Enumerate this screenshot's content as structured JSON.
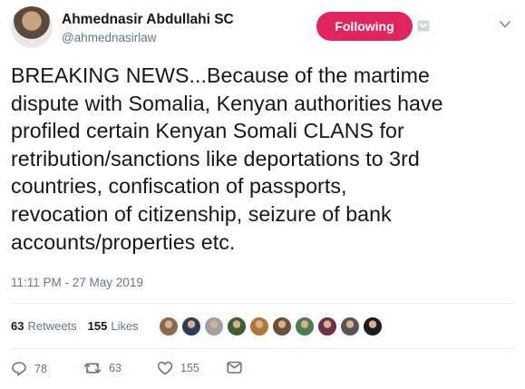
{
  "author": {
    "name": "Ahmednasir Abdullahi SC",
    "handle": "@ahmednasirlaw",
    "follow_button_label": "Following"
  },
  "tweet": {
    "text": "BREAKING NEWS...Because of the martime\ndispute with Somalia, Kenyan authorities have\nprofiled certain Kenyan Somali CLANS for\nretribution/sanctions like deportations to 3rd\ncountries,  confiscation of passports,\nrevocation of citizenship, seizure of bank\naccounts/properties etc.",
    "timestamp": "11:11 PM - 27 May 2019"
  },
  "stats": {
    "retweets_count": "63",
    "retweets_label": "Retweets",
    "likes_count": "155",
    "likes_label": "Likes"
  },
  "liker_avatars": [
    {
      "color": "#8a6a4f"
    },
    {
      "color": "#2f3b5c"
    },
    {
      "color": "#a0a0a0"
    },
    {
      "color": "#3d5e2f"
    },
    {
      "color": "#b0733a"
    },
    {
      "color": "#6b4f3a"
    },
    {
      "color": "#4e7d54"
    },
    {
      "color": "#6a2f4a"
    },
    {
      "color": "#555555"
    },
    {
      "color": "#1c1c1c"
    }
  ],
  "actions": {
    "replies": "78",
    "retweets": "63",
    "likes": "155"
  },
  "colors": {
    "follow_button": "#e0245e",
    "secondary_text": "#657786",
    "icon": "#657786"
  },
  "icons": [
    "reply-icon",
    "retweet-icon",
    "like-icon",
    "direct-message-icon",
    "chevron-down-icon"
  ]
}
